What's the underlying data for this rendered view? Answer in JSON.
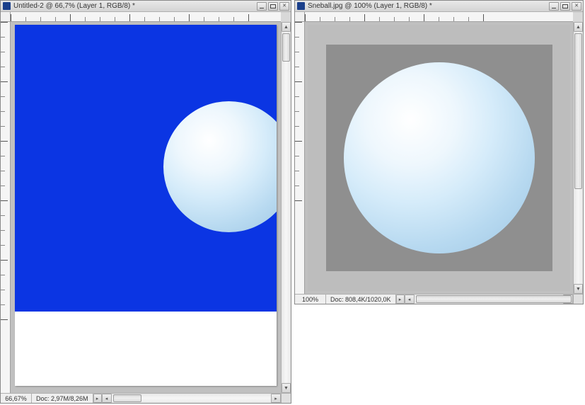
{
  "window1": {
    "title": "Untitled-2 @ 66,7% (Layer 1, RGB/8) *",
    "zoom": "66,67%",
    "doc_label": "Doc: 2,97M/8,26M",
    "ruler_major": [
      "0",
      "5",
      "10",
      "15",
      "20"
    ]
  },
  "window2": {
    "title": "Sneball.jpg @ 100% (Layer 1, RGB/8) *",
    "zoom": "100%",
    "doc_label": "Doc: 808,4K/1020,0K",
    "ruler_major": [
      "0",
      "5",
      "10",
      "15"
    ]
  }
}
